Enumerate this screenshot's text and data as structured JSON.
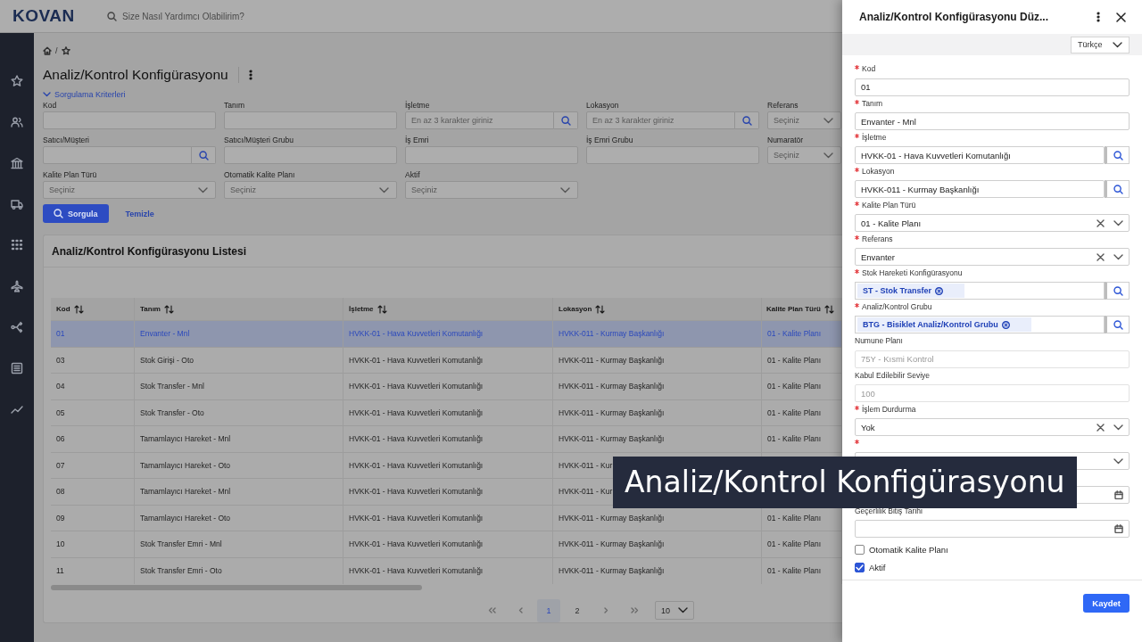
{
  "header": {
    "logo": "KOVAN",
    "search": {
      "placeholder": "Size Nasıl Yardımcı Olabilirim?"
    }
  },
  "breadcrumb": {
    "separator": "/"
  },
  "page": {
    "title": "Analiz/Kontrol Konfigürasyonu"
  },
  "filters": {
    "toggle": "Sorgulama Kriterleri",
    "expanded": true,
    "fields": [
      {
        "label": "Kod",
        "kind": "text"
      },
      {
        "label": "Tanım",
        "kind": "text"
      },
      {
        "label": "İşletme",
        "kind": "lookup",
        "placeholder": "En az 3 karakter giriniz"
      },
      {
        "label": "Lokasyon",
        "kind": "lookup",
        "placeholder": "En az 3 karakter giriniz"
      },
      {
        "label": "Referans",
        "kind": "select",
        "placeholder": "Seçiniz"
      },
      {
        "label": "Satıcı/Müşteri",
        "kind": "lookup"
      },
      {
        "label": "Satıcı/Müşteri Grubu",
        "kind": "text"
      },
      {
        "label": "İş Emri",
        "kind": "text"
      },
      {
        "label": "İş Emri Grubu",
        "kind": "text"
      },
      {
        "label": "Numaratör",
        "kind": "select",
        "placeholder": "Seçiniz"
      },
      {
        "label": "Kalite Plan Türü",
        "kind": "select",
        "placeholder": "Seçiniz"
      },
      {
        "label": "Otomatik Kalite Planı",
        "kind": "select",
        "placeholder": "Seçiniz"
      },
      {
        "label": "Aktif",
        "kind": "select",
        "placeholder": "Seçiniz"
      }
    ],
    "buttons": [
      {
        "label": "Sorgula",
        "kind": "primary"
      },
      {
        "label": "Temizle",
        "kind": "link"
      }
    ]
  },
  "table": {
    "title": "Analiz/Kontrol Konfigürasyonu Listesi",
    "columns": [
      {
        "label": "Kod"
      },
      {
        "label": "Tanım"
      },
      {
        "label": "İşletme"
      },
      {
        "label": "Lokasyon"
      },
      {
        "label": "Kalite Plan Türü"
      }
    ],
    "rows": [
      {
        "selected": true,
        "cells": [
          "01",
          "Envanter - Mnl",
          "HVKK-01 - Hava Kuvvetleri Komutanlığı",
          "HVKK-011 - Kurmay Başkanlığı",
          "01 - Kalite Planı"
        ]
      },
      {
        "selected": false,
        "cells": [
          "03",
          "Stok Girişi - Oto",
          "HVKK-01 - Hava Kuvvetleri Komutanlığı",
          "HVKK-011 - Kurmay Başkanlığı",
          "01 - Kalite Planı"
        ]
      },
      {
        "selected": false,
        "cells": [
          "04",
          "Stok Transfer - Mnl",
          "HVKK-01 - Hava Kuvvetleri Komutanlığı",
          "HVKK-011 - Kurmay Başkanlığı",
          "01 - Kalite Planı"
        ]
      },
      {
        "selected": false,
        "cells": [
          "05",
          "Stok Transfer - Oto",
          "HVKK-01 - Hava Kuvvetleri Komutanlığı",
          "HVKK-011 - Kurmay Başkanlığı",
          "01 - Kalite Planı"
        ]
      },
      {
        "selected": false,
        "cells": [
          "06",
          "Tamamlayıcı Hareket - Mnl",
          "HVKK-01 - Hava Kuvvetleri Komutanlığı",
          "HVKK-011 - Kurmay Başkanlığı",
          "01 - Kalite Planı"
        ]
      },
      {
        "selected": false,
        "cells": [
          "07",
          "Tamamlayıcı Hareket - Oto",
          "HVKK-01 - Hava Kuvvetleri Komutanlığı",
          "HVKK-011 - Kur"
        ]
      },
      {
        "selected": false,
        "cells": [
          "08",
          "Tamamlayıcı Hareket - Mnl",
          "HVKK-01 - Hava Kuvvetleri Komutanlığı",
          "HVKK-011 - Kur"
        ]
      },
      {
        "selected": false,
        "cells": [
          "09",
          "Tamamlayıcı Hareket - Oto",
          "HVKK-01 - Hava Kuvvetleri Komutanlığı",
          "HVKK-011 - Kurmay Başkanlığı",
          "01 - Kalite Planı"
        ]
      },
      {
        "selected": false,
        "cells": [
          "10",
          "Stok Transfer Emri - Mnl",
          "HVKK-01 - Hava Kuvvetleri Komutanlığı",
          "HVKK-011 - Kurmay Başkanlığı",
          "01 - Kalite Planı"
        ]
      },
      {
        "selected": false,
        "cells": [
          "11",
          "Stok Transfer Emri - Oto",
          "HVKK-01 - Hava Kuvvetleri Komutanlığı",
          "HVKK-011 - Kurmay Başkanlığı",
          "01 - Kalite Planı"
        ]
      }
    ],
    "pagination": {
      "pages": [
        {
          "label": "1",
          "selected": true
        },
        {
          "label": "2",
          "selected": false
        }
      ],
      "page_size": "10"
    }
  },
  "panel": {
    "title": "Analiz/Kontrol Konfigürasyonu Düz...",
    "language": "Türkçe",
    "fields": [
      {
        "kind": "text",
        "label": "Kod",
        "required": true,
        "value": "01",
        "disabled": false
      },
      {
        "kind": "text",
        "label": "Tanım",
        "required": true,
        "value": "Envanter - Mnl",
        "disabled": false
      },
      {
        "kind": "lookup",
        "label": "İşletme",
        "required": true,
        "value": "HVKK-01 - Hava Kuvvetleri Komutanlığı"
      },
      {
        "kind": "lookup",
        "label": "Lokasyon",
        "required": true,
        "value": "HVKK-011 - Kurmay Başkanlığı"
      },
      {
        "kind": "select",
        "label": "Kalite Plan Türü",
        "required": true,
        "value": "01 - Kalite Planı",
        "clearable": true
      },
      {
        "kind": "select",
        "label": "Referans",
        "required": true,
        "value": "Envanter",
        "clearable": true
      },
      {
        "kind": "tags",
        "label": "Stok Hareketi Konfigürasyonu",
        "required": true,
        "tags": [
          "ST - Stok Transfer"
        ]
      },
      {
        "kind": "tags",
        "label": "Analiz/Kontrol Grubu",
        "required": true,
        "tags": [
          "BTG - Bisiklet Analiz/Kontrol Grubu"
        ]
      },
      {
        "kind": "text",
        "label": "Numune Planı",
        "required": false,
        "value": "75Y - Kısmi Kontrol",
        "disabled": true
      },
      {
        "kind": "text",
        "label": "Kabul Edilebilir Seviye",
        "required": false,
        "value": "100",
        "disabled": true
      },
      {
        "kind": "select",
        "label": "İşlem Durdurma",
        "required": true,
        "value": "Yok",
        "clearable": true
      },
      {
        "kind": "select",
        "required": true,
        "clearable": false
      },
      {
        "kind": "date"
      },
      {
        "kind": "date",
        "label": "Geçerlilik Bitiş Tarihi"
      },
      {
        "kind": "checkbox",
        "label": "Otomatik Kalite Planı",
        "checked": false
      },
      {
        "kind": "checkbox",
        "label": "Aktif",
        "checked": true
      }
    ],
    "save": "Kaydet"
  },
  "caption": "Analiz/Kontrol Konfigürasyonu"
}
